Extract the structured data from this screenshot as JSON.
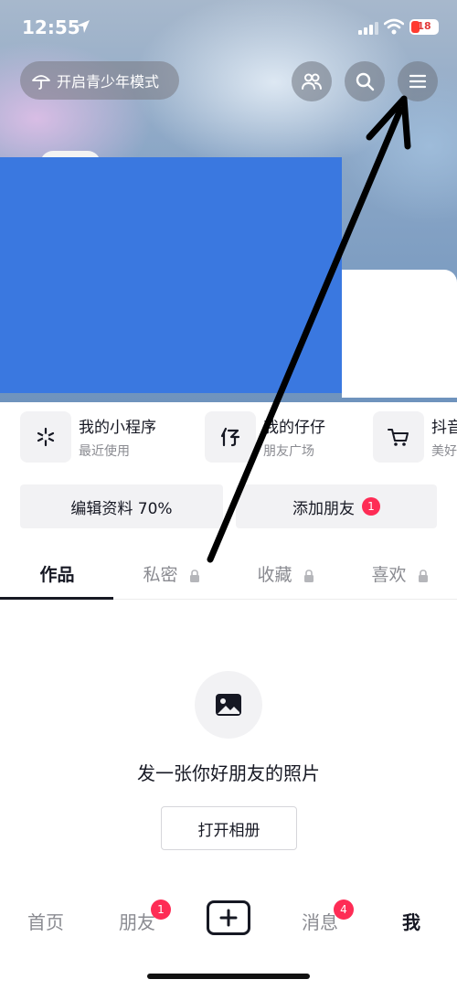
{
  "status_bar": {
    "time": "12:55",
    "battery": "18"
  },
  "header": {
    "teen_mode_label": "开启青少年模式"
  },
  "mini_programs": [
    {
      "title": "我的小程序",
      "subtitle": "最近使用",
      "icon": "mini-program-icon"
    },
    {
      "title": "我的仔仔",
      "subtitle": "朋友广场",
      "icon": "zaizai-icon"
    },
    {
      "title": "抖音",
      "subtitle": "美好",
      "icon": "cart-icon"
    }
  ],
  "actions": {
    "edit_profile": "编辑资料 70%",
    "add_friend": "添加朋友",
    "add_friend_badge": "1"
  },
  "tabs": [
    {
      "label": "作品"
    },
    {
      "label": "私密"
    },
    {
      "label": "收藏"
    },
    {
      "label": "喜欢"
    }
  ],
  "empty_state": {
    "title": "发一张你好朋友的照片",
    "button": "打开相册"
  },
  "bottom_nav": {
    "home": "首页",
    "friends": "朋友",
    "friends_badge": "1",
    "messages": "消息",
    "messages_badge": "4",
    "me": "我"
  },
  "colors": {
    "accent": "#fe2c55",
    "cover_blue": "#3a78e0",
    "text": "#161823",
    "muted": "#8a8b91"
  }
}
